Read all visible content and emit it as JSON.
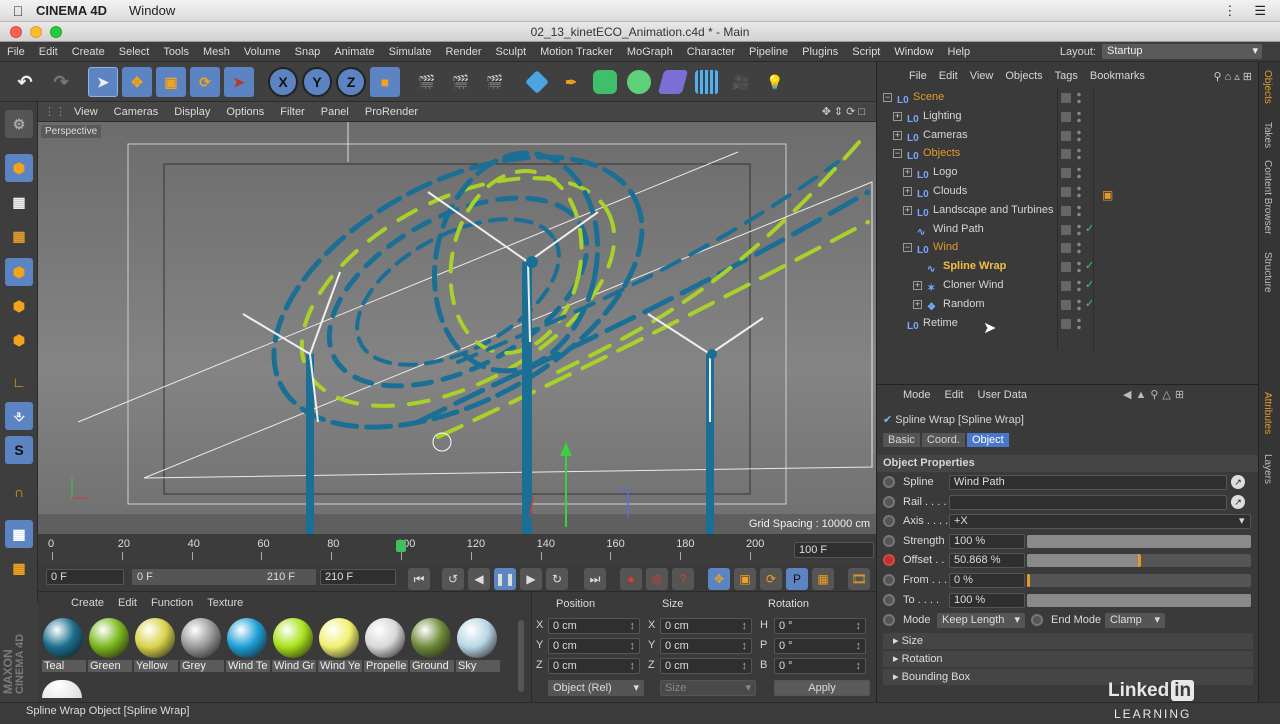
{
  "mac_menubar": {
    "app_name": "CINEMA 4D",
    "menu": "Window"
  },
  "window": {
    "title": "02_13_kinetECO_Animation.c4d * - Main"
  },
  "main_menu": [
    "File",
    "Edit",
    "Create",
    "Select",
    "Tools",
    "Mesh",
    "Volume",
    "Snap",
    "Animate",
    "Simulate",
    "Render",
    "Sculpt",
    "Motion Tracker",
    "MoGraph",
    "Character",
    "Pipeline",
    "Plugins",
    "Script",
    "Window",
    "Help"
  ],
  "layout": {
    "label": "Layout:",
    "value": "Startup"
  },
  "toolbar_axes": [
    "X",
    "Y",
    "Z"
  ],
  "viewport": {
    "menu": [
      "View",
      "Cameras",
      "Display",
      "Options",
      "Filter",
      "Panel",
      "ProRender"
    ],
    "name": "Perspective",
    "grid_spacing": "Grid Spacing : 10000 cm"
  },
  "timeline": {
    "ticks": [
      "0",
      "20",
      "40",
      "60",
      "80",
      "100",
      "120",
      "140",
      "160",
      "180",
      "200"
    ],
    "end_frame": "100 F",
    "playhead_frame": 100,
    "max_frame": 210
  },
  "transport": {
    "current": "0 F",
    "range_start": "0 F",
    "range_end": "210 F",
    "max": "210 F"
  },
  "materials": {
    "menu": [
      "Create",
      "Edit",
      "Function",
      "Texture"
    ],
    "items": [
      {
        "label": "Teal",
        "color": "#1d6e8f"
      },
      {
        "label": "Green",
        "color": "#7bb81e"
      },
      {
        "label": "Yellow",
        "color": "#d8d24a"
      },
      {
        "label": "Grey",
        "color": "#9a9a9a"
      },
      {
        "label": "Wind Te",
        "color": "#1e9fd6"
      },
      {
        "label": "Wind Gr",
        "color": "#a8e21a"
      },
      {
        "label": "Wind Ye",
        "color": "#f1f070"
      },
      {
        "label": "Propelle",
        "color": "#d8d8d8"
      },
      {
        "label": "Ground",
        "color": "#6f8a3a"
      },
      {
        "label": "Sky",
        "color": "#b9d6e6"
      }
    ]
  },
  "coords": {
    "headers": [
      "Position",
      "Size",
      "Rotation"
    ],
    "rows": [
      {
        "pos_axis": "X",
        "pos": "0 cm",
        "size_axis": "X",
        "size": "0 cm",
        "rot_axis": "H",
        "rot": "0 °"
      },
      {
        "pos_axis": "Y",
        "pos": "0 cm",
        "size_axis": "Y",
        "size": "0 cm",
        "rot_axis": "P",
        "rot": "0 °"
      },
      {
        "pos_axis": "Z",
        "pos": "0 cm",
        "size_axis": "Z",
        "size": "0 cm",
        "rot_axis": "B",
        "rot": "0 °"
      }
    ],
    "mode": "Object (Rel)",
    "size_mode": "Size",
    "apply": "Apply"
  },
  "object_manager": {
    "menu": [
      "File",
      "Edit",
      "View",
      "Objects",
      "Tags",
      "Bookmarks"
    ],
    "objects": [
      {
        "name": "Scene",
        "depth": 0,
        "expander": "−",
        "highlight": "orange"
      },
      {
        "name": "Lighting",
        "depth": 1,
        "expander": "+",
        "highlight": "none"
      },
      {
        "name": "Cameras",
        "depth": 1,
        "expander": "+",
        "highlight": "none"
      },
      {
        "name": "Objects",
        "depth": 1,
        "expander": "−",
        "highlight": "orange"
      },
      {
        "name": "Logo",
        "depth": 2,
        "expander": "+",
        "highlight": "none"
      },
      {
        "name": "Clouds",
        "depth": 2,
        "expander": "+",
        "highlight": "none"
      },
      {
        "name": "Landscape and Turbines",
        "depth": 2,
        "expander": "+",
        "highlight": "none"
      },
      {
        "name": "Wind Path",
        "depth": 2,
        "expander": "",
        "highlight": "none"
      },
      {
        "name": "Wind",
        "depth": 2,
        "expander": "−",
        "highlight": "orange"
      },
      {
        "name": "Spline Wrap",
        "depth": 3,
        "expander": "",
        "highlight": "selected"
      },
      {
        "name": "Cloner Wind",
        "depth": 3,
        "expander": "+",
        "highlight": "none"
      },
      {
        "name": "Random",
        "depth": 3,
        "expander": "+",
        "highlight": "none"
      },
      {
        "name": "Retime",
        "depth": 1,
        "expander": "",
        "highlight": "none"
      }
    ]
  },
  "attributes": {
    "menu": [
      "Mode",
      "Edit",
      "User Data"
    ],
    "object_title": "Spline Wrap [Spline Wrap]",
    "tabs": [
      "Basic",
      "Coord.",
      "Object"
    ],
    "active_tab": "Object",
    "section": "Object Properties",
    "props": [
      {
        "label": "Spline",
        "value": "Wind Path",
        "type": "link"
      },
      {
        "label": "Rail . . . .",
        "value": "",
        "type": "link"
      },
      {
        "label": "Axis . . . .",
        "value": "+X",
        "type": "dropdown"
      },
      {
        "label": "Strength",
        "value": "100 %",
        "type": "slider",
        "fraction": 1.0
      },
      {
        "label": "Offset . .",
        "value": "50.868 %",
        "type": "slider",
        "fraction": 0.50868
      },
      {
        "label": "From . . .",
        "value": "0 %",
        "type": "slider",
        "fraction": 0.0
      },
      {
        "label": "To . . . .",
        "value": "100 %",
        "type": "slider",
        "fraction": 1.0
      }
    ],
    "mode_label": "Mode",
    "mode_value": "Keep Length",
    "end_mode_label": "End Mode",
    "end_mode_value": "Clamp",
    "sections": [
      "Size",
      "Rotation",
      "Bounding Box"
    ]
  },
  "right_tabs_top": [
    "Objects",
    "Takes",
    "Content Browser",
    "Structure"
  ],
  "right_tabs_bottom": [
    "Attributes",
    "Layers"
  ],
  "status_text": "Spline Wrap Object [Spline Wrap]",
  "watermark": {
    "brand": "Linked",
    "badge": "in",
    "sub": "LEARNING"
  },
  "maxon": {
    "line1": "MAXON",
    "line2": "CINEMA 4D"
  },
  "colors": {
    "accent_orange": "#e39a2c",
    "selected_text": "#f0c040",
    "viewport_teal": "#1b6f95",
    "viewport_green": "#a8d12a"
  }
}
